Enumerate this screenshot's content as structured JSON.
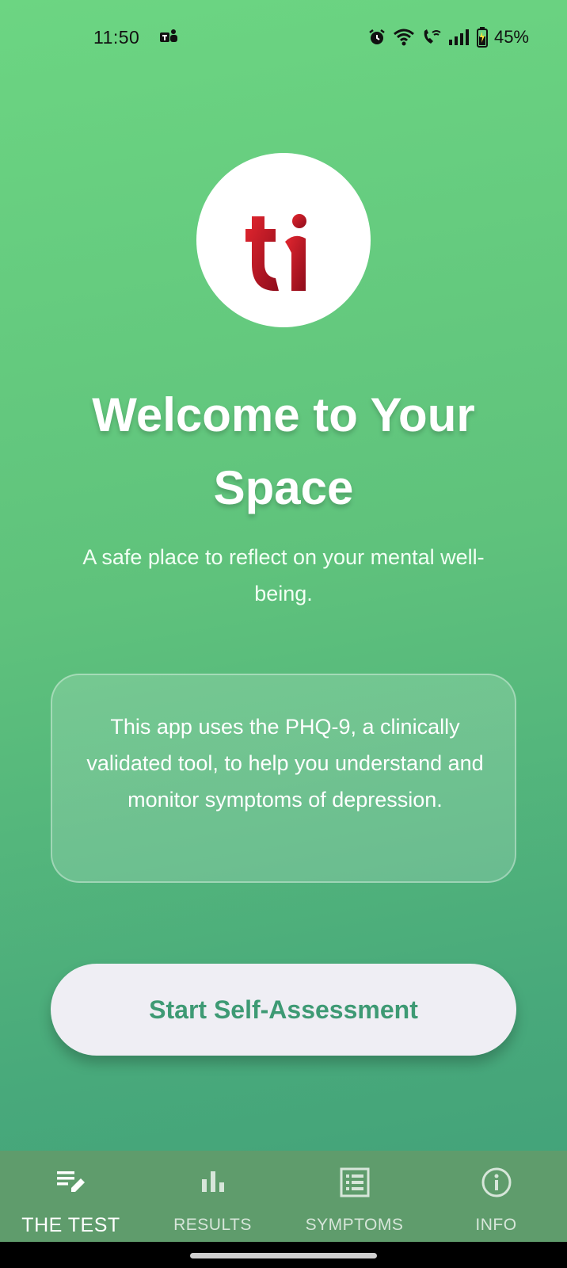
{
  "status_bar": {
    "time": "11:50",
    "battery": "45%"
  },
  "welcome": {
    "title": "Welcome to Your Space",
    "subtitle": "A safe place to reflect on your mental well-being."
  },
  "info_card": {
    "text": "This app uses the PHQ-9, a clinically validated tool, to help you understand and monitor symptoms of depression."
  },
  "start_button": {
    "label": "Start Self-Assessment"
  },
  "bottom_nav": {
    "items": [
      {
        "label": "THE TEST",
        "icon": "edit-list-icon",
        "active": true
      },
      {
        "label": "RESULTS",
        "icon": "bar-chart-icon",
        "active": false
      },
      {
        "label": "SYMPTOMS",
        "icon": "list-alt-icon",
        "active": false
      },
      {
        "label": "INFO",
        "icon": "info-icon",
        "active": false
      }
    ]
  },
  "colors": {
    "background_top": "#6cd582",
    "background_bottom": "#419f79",
    "nav_background": "#5f9c6c",
    "button_text": "#3e9a74",
    "logo_red": "#c8102e"
  }
}
